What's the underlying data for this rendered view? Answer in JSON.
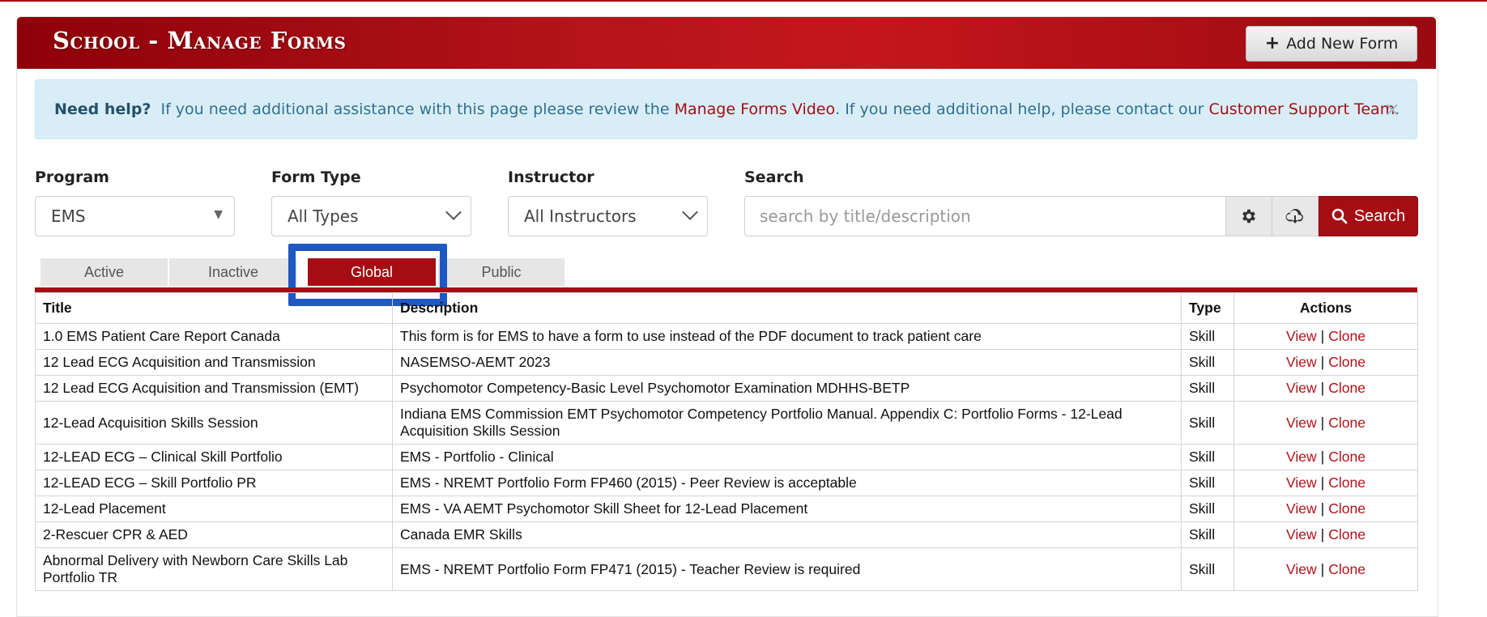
{
  "header": {
    "title": "School - Manage Forms",
    "add_button_label": "Add New Form"
  },
  "help": {
    "lead": "Need help?",
    "text1": " If you need additional assistance with this page please review the ",
    "link1": "Manage Forms Video",
    "text2": ". If you need additional help, please contact our ",
    "link2": "Customer Support Team",
    "text3": ".",
    "close": "×"
  },
  "filters": {
    "program_label": "Program",
    "program_value": "EMS",
    "form_type_label": "Form Type",
    "form_type_value": "All Types",
    "instructor_label": "Instructor",
    "instructor_value": "All Instructors",
    "search_label": "Search",
    "search_placeholder": "search by title/description",
    "search_button": "Search"
  },
  "tabs": [
    {
      "label": "Active",
      "active": false
    },
    {
      "label": "Inactive",
      "active": false
    },
    {
      "label": "Global",
      "active": true
    },
    {
      "label": "Public",
      "active": false
    }
  ],
  "table": {
    "headers": [
      "Title",
      "Description",
      "Type",
      "Actions"
    ],
    "view_label": "View",
    "clone_label": "Clone",
    "action_separator": "|",
    "rows": [
      {
        "title": "1.0 EMS Patient Care Report Canada",
        "description": "This form is for EMS to have a form to use instead of the PDF document to track patient care",
        "type": "Skill"
      },
      {
        "title": "12 Lead ECG Acquisition and Transmission",
        "description": "NASEMSO-AEMT 2023",
        "type": "Skill"
      },
      {
        "title": "12 Lead ECG Acquisition and Transmission (EMT)",
        "description": "Psychomotor Competency-Basic Level Psychomotor Examination MDHHS-BETP",
        "type": "Skill"
      },
      {
        "title": "12-Lead Acquisition Skills Session",
        "description": "Indiana EMS Commission EMT Psychomotor Competency Portfolio Manual. Appendix C: Portfolio Forms - 12-Lead Acquisition Skills Session",
        "type": "Skill"
      },
      {
        "title": "12-LEAD ECG – Clinical Skill Portfolio",
        "description": "EMS - Portfolio - Clinical",
        "type": "Skill"
      },
      {
        "title": "12-LEAD ECG – Skill Portfolio PR",
        "description": "EMS - NREMT Portfolio Form FP460 (2015) - Peer Review is acceptable",
        "type": "Skill"
      },
      {
        "title": "12-Lead Placement",
        "description": "EMS - VA AEMT Psychomotor Skill Sheet for 12-Lead Placement",
        "type": "Skill"
      },
      {
        "title": "2-Rescuer CPR & AED",
        "description": "Canada EMR Skills",
        "type": "Skill"
      },
      {
        "title": "Abnormal Delivery with Newborn Care Skills Lab Portfolio TR",
        "description": "EMS - NREMT Portfolio Form FP471 (2015) - Teacher Review is required",
        "type": "Skill"
      }
    ]
  },
  "colors": {
    "brand_red": "#a40d13",
    "highlight_blue": "#1f57c3",
    "alert_bg": "#d9edf7"
  }
}
